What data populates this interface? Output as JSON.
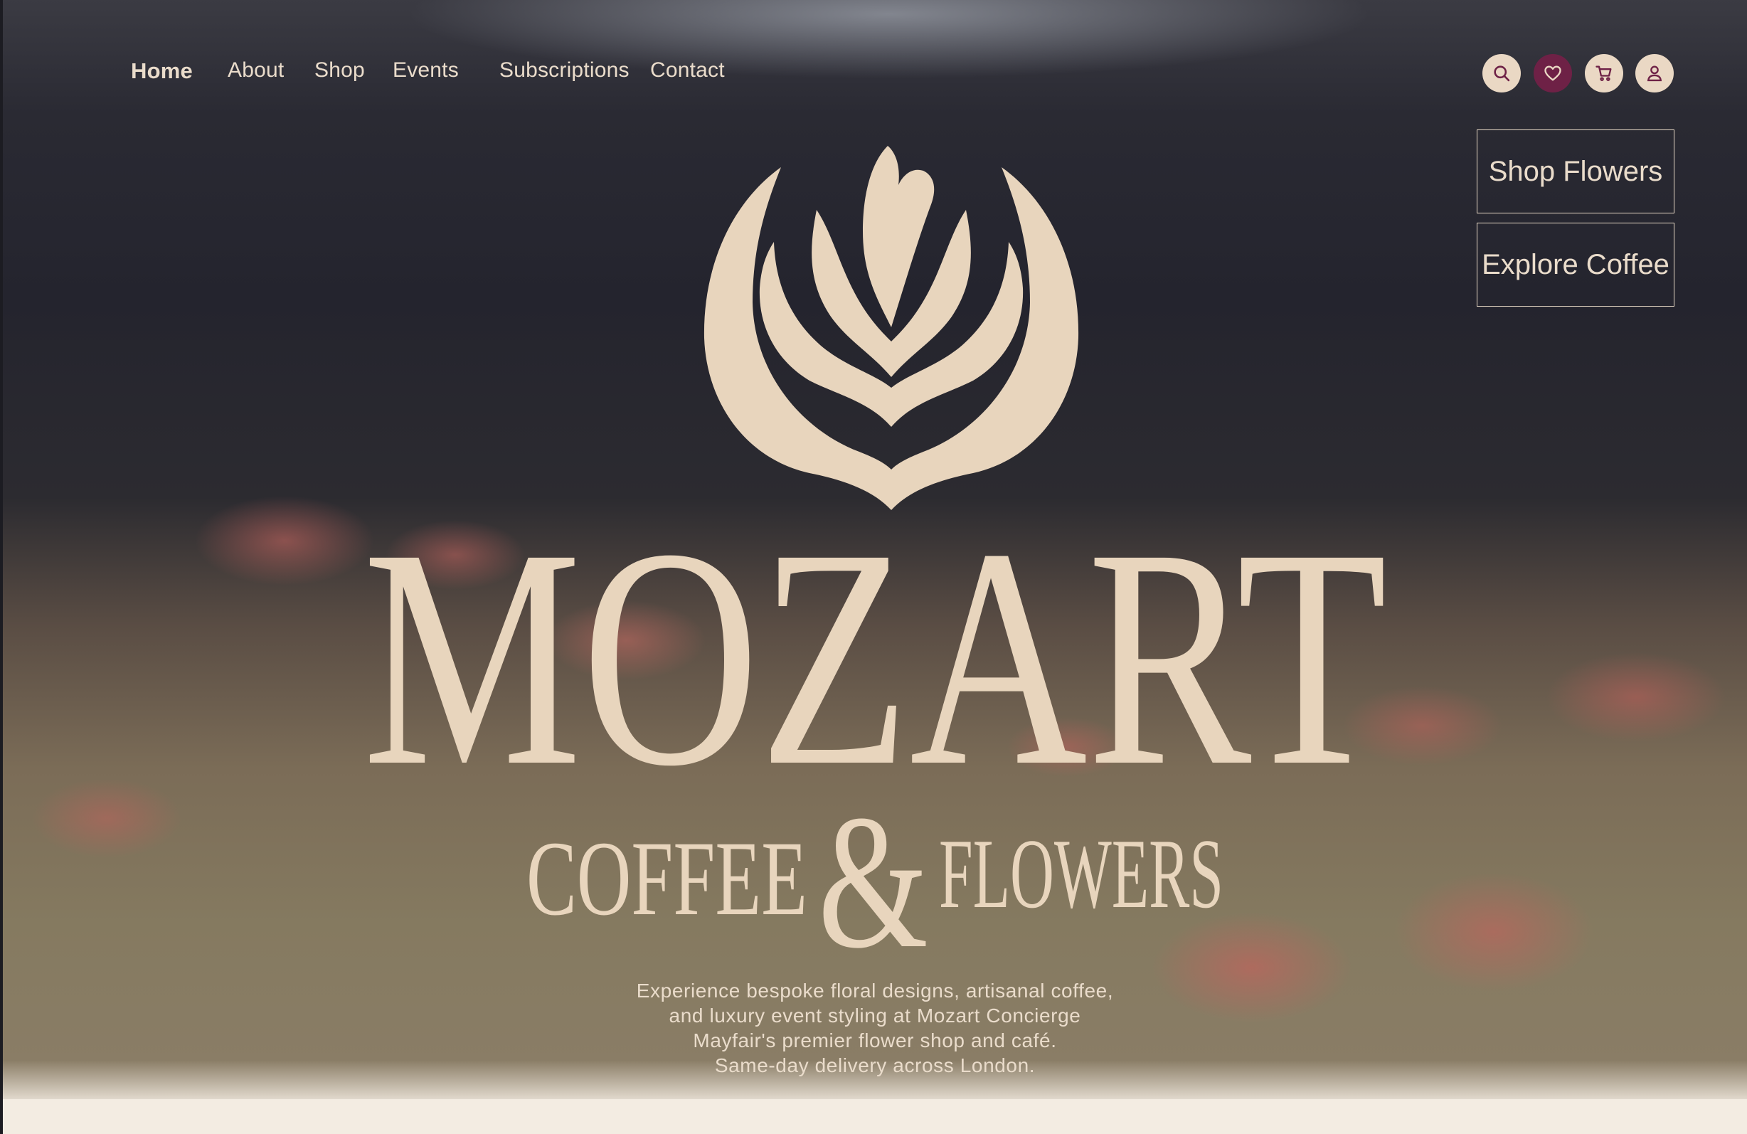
{
  "nav": {
    "items": [
      "Home",
      "About",
      "Shop",
      "Events",
      "Subscriptions",
      "Contact"
    ],
    "active": "Home"
  },
  "header_icons": [
    "search-icon",
    "heart-icon",
    "cart-icon",
    "user-icon"
  ],
  "cta": {
    "shop_flowers": "Shop Flowers",
    "explore_coffee": "Explore Coffee"
  },
  "brand": {
    "name": "MOZART",
    "tagline_left": "COFFEE",
    "ampersand": "&",
    "tagline_right": "FLOWERS"
  },
  "description": {
    "line1": "Experience bespoke floral designs, artisanal coffee,",
    "line2": "and luxury event styling at Mozart Concierge",
    "line3": "Mayfair's premier flower shop and café.",
    "line4": "Same-day delivery across London."
  },
  "colors": {
    "cream": "#eadccb",
    "plum": "#6e2146",
    "dark_bg": "#24242e"
  }
}
